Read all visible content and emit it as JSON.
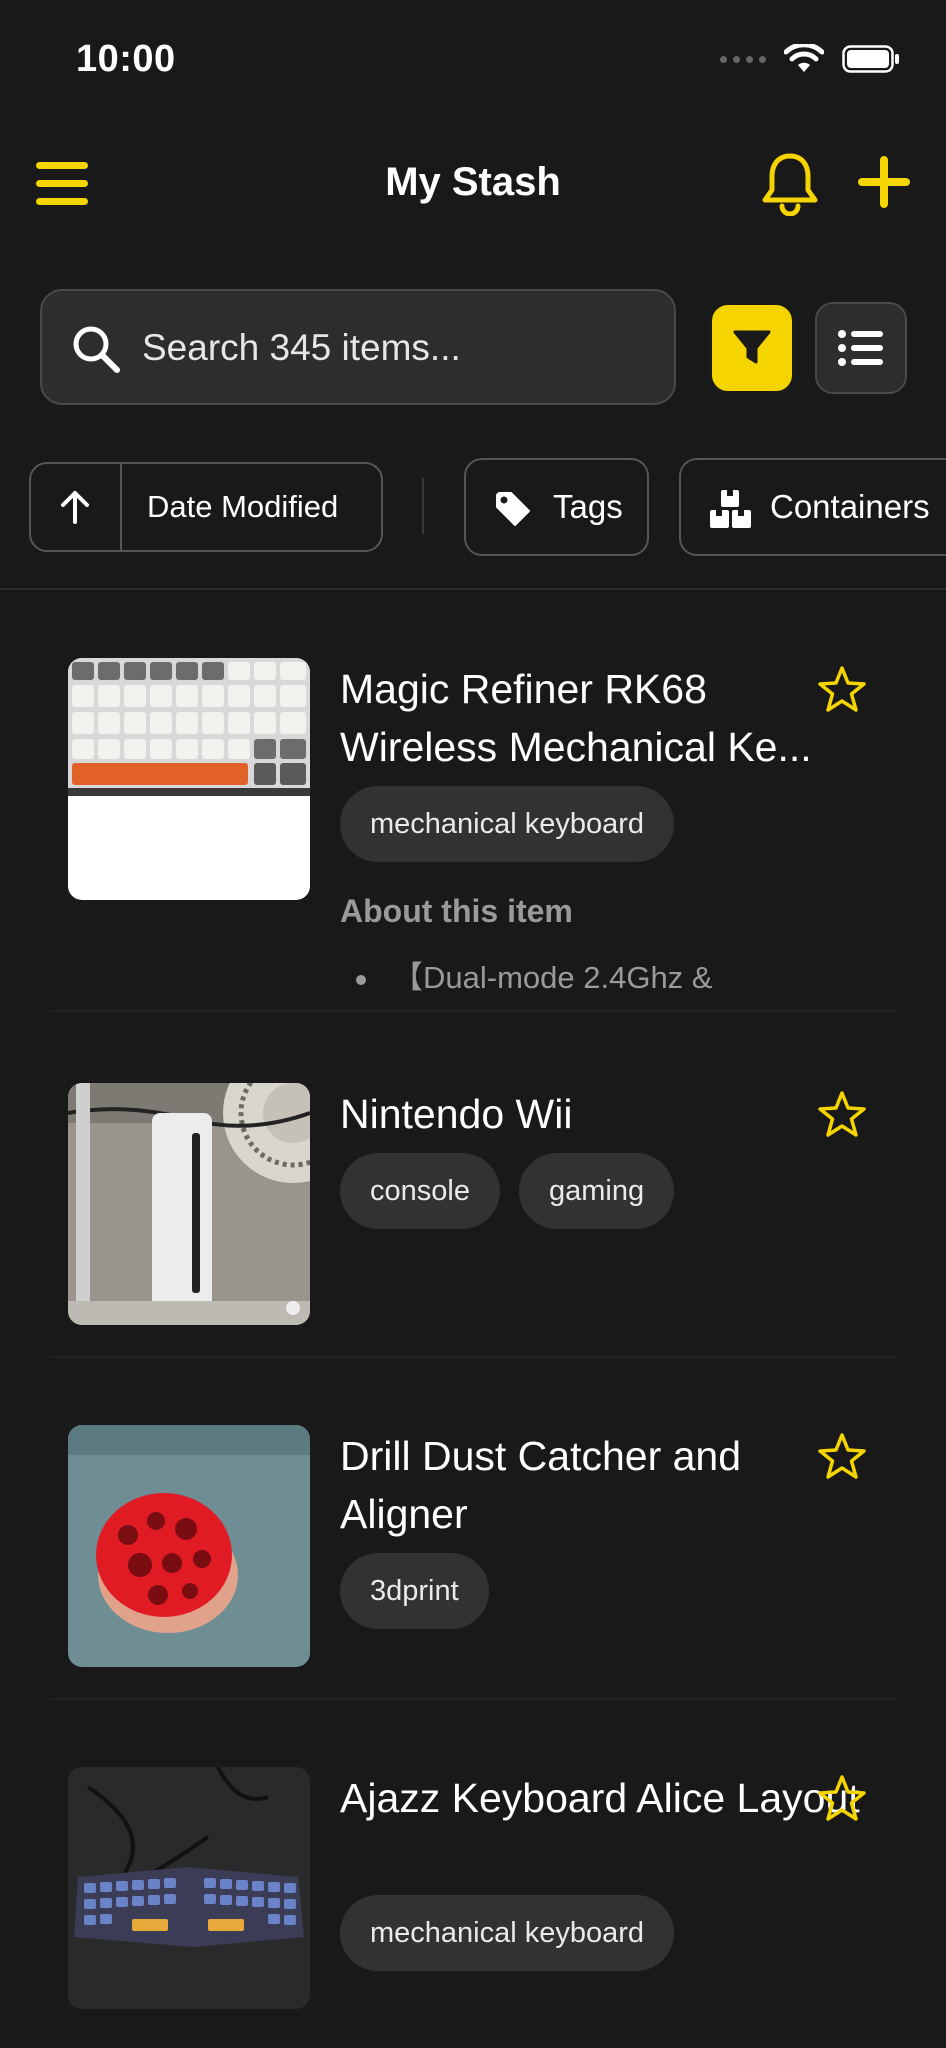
{
  "status_bar": {
    "time": "10:00"
  },
  "header": {
    "title": "My Stash"
  },
  "search": {
    "placeholder": "Search 345 items..."
  },
  "filters": {
    "sort_label": "Date Modified",
    "tags_label": "Tags",
    "containers_label": "Containers"
  },
  "colors": {
    "accent": "#f5d400",
    "background": "#191919",
    "chip_bg": "#323234"
  },
  "items": [
    {
      "title": "Magic Refiner RK68 Wireless Mechanical Ke...",
      "tags": [
        "mechanical keyboard"
      ],
      "about_label": "About this item",
      "description": "【Dual-mode 2.4Ghz &",
      "favorite": false
    },
    {
      "title": "Nintendo Wii",
      "tags": [
        "console",
        "gaming"
      ],
      "favorite": false
    },
    {
      "title": "Drill Dust Catcher and Aligner",
      "tags": [
        "3dprint"
      ],
      "favorite": false
    },
    {
      "title": "Ajazz Keyboard Alice Layout",
      "tags": [
        "mechanical keyboard"
      ],
      "favorite": false
    }
  ]
}
